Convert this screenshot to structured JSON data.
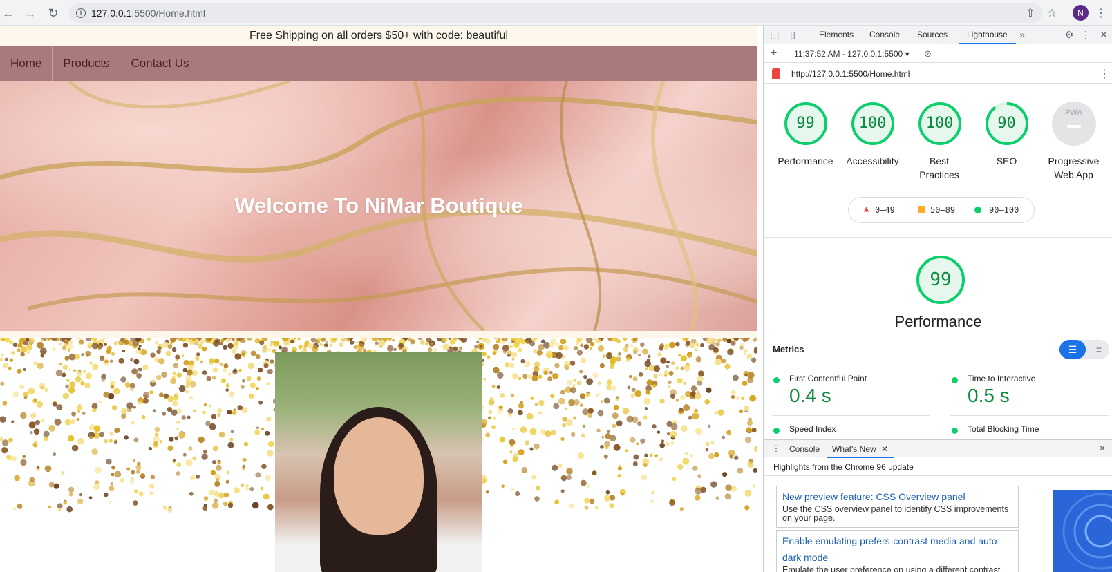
{
  "browser": {
    "url_host": "127.0.0.1",
    "url_rest": ":5500/Home.html",
    "avatar_letter": "N"
  },
  "site": {
    "promo": "Free Shipping on all orders $50+ with code: beautiful",
    "nav": [
      "Home",
      "Products",
      "Contact Us"
    ],
    "hero_title": "Welcome To NiMar Boutique"
  },
  "devtools": {
    "tabs": [
      "Elements",
      "Console",
      "Sources",
      "Lighthouse"
    ],
    "active_tab": "Lighthouse",
    "report_time": "11:37:52 AM - 127.0.0.1:5500",
    "report_url": "http://127.0.0.1:5500/Home.html",
    "scores": [
      {
        "label": "Performance",
        "value": "99"
      },
      {
        "label": "Accessibility",
        "value": "100"
      },
      {
        "label": "Best Practices",
        "value": "100"
      },
      {
        "label": "SEO",
        "value": "90"
      }
    ],
    "pwa": {
      "badge": "PWA",
      "label_line1": "Progressive",
      "label_line2": "Web App"
    },
    "legend": {
      "red": "0–49",
      "orange": "50–89",
      "green": "90–100"
    },
    "performance_score": "99",
    "performance_title": "Performance",
    "metrics_heading": "Metrics",
    "metrics": [
      {
        "name": "First Contentful Paint",
        "value": "0.4 s"
      },
      {
        "name": "Time to Interactive",
        "value": "0.5 s"
      },
      {
        "name": "Speed Index",
        "value": ""
      },
      {
        "name": "Total Blocking Time",
        "value": ""
      }
    ],
    "drawer_tabs": [
      "Console",
      "What's New"
    ],
    "drawer_heading": "Highlights from the Chrome 96 update",
    "news": [
      {
        "title": "New preview feature: CSS Overview panel",
        "desc": "Use the CSS overview panel to identify CSS improvements on your page."
      },
      {
        "title": "Enable emulating prefers-contrast media and auto dark mode",
        "desc": "Emulate the user preference on using a different contrast"
      }
    ]
  },
  "colors": {
    "score_green": "#0cce6b",
    "nav_bg": "#a87a7c",
    "promo_bg": "#fdf6ea",
    "devtools_accent": "#1a73e8"
  }
}
